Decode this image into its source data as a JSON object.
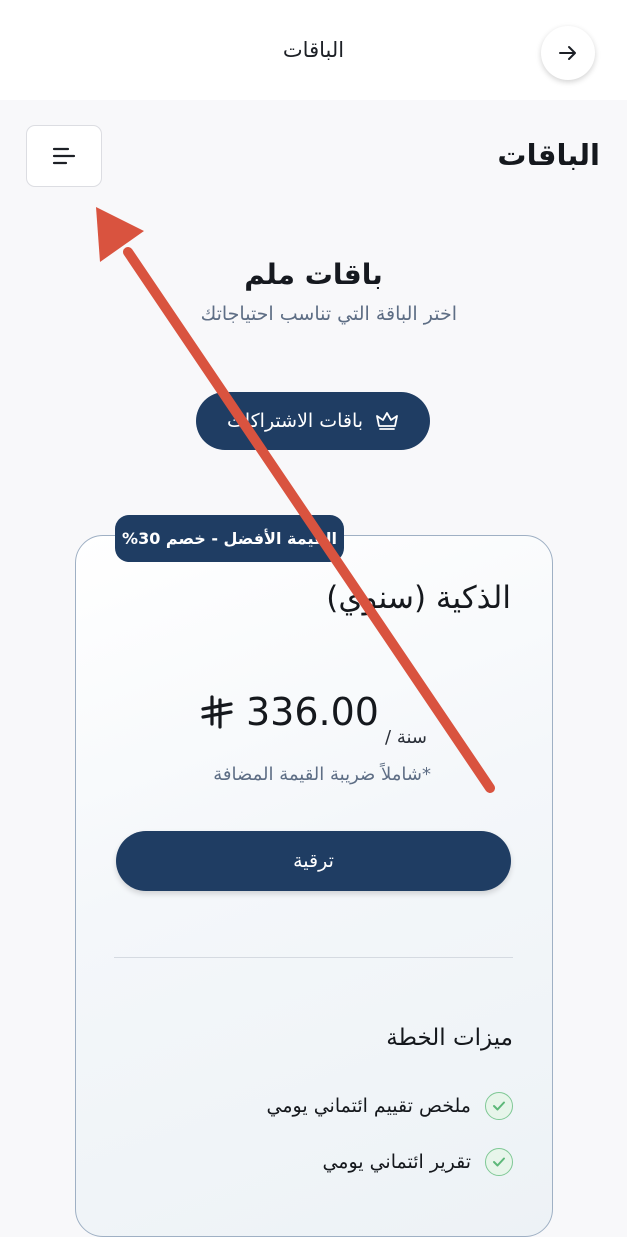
{
  "topbar": {
    "title": "الباقات",
    "back_icon": "arrow-right-icon"
  },
  "page": {
    "heading": "الباقات",
    "menu_icon": "menu-lines-icon"
  },
  "brand": {
    "title": "باقات ملم",
    "subtitle": "اختر الباقة التي تناسب احتياجاتك"
  },
  "subscriptions_button": {
    "label": "باقات الاشتراكات",
    "icon": "crown-icon"
  },
  "plan": {
    "badge": "القيمة الأفضل - خصم 30%",
    "name": "الذكية (سنوي)",
    "price": "336.00",
    "currency_icon": "riyal-icon",
    "period": "سنة /",
    "vat_note": "*شاملاً ضريبة القيمة المضافة",
    "upgrade_label": "ترقية"
  },
  "features": {
    "title": "ميزات الخطة",
    "items": [
      {
        "label": "ملخص تقييم ائتماني يومي"
      },
      {
        "label": "تقرير ائتماني يومي"
      }
    ]
  },
  "colors": {
    "primary": "#1f3d63",
    "annotation_arrow": "#d9533f",
    "check": "#7fc895"
  }
}
